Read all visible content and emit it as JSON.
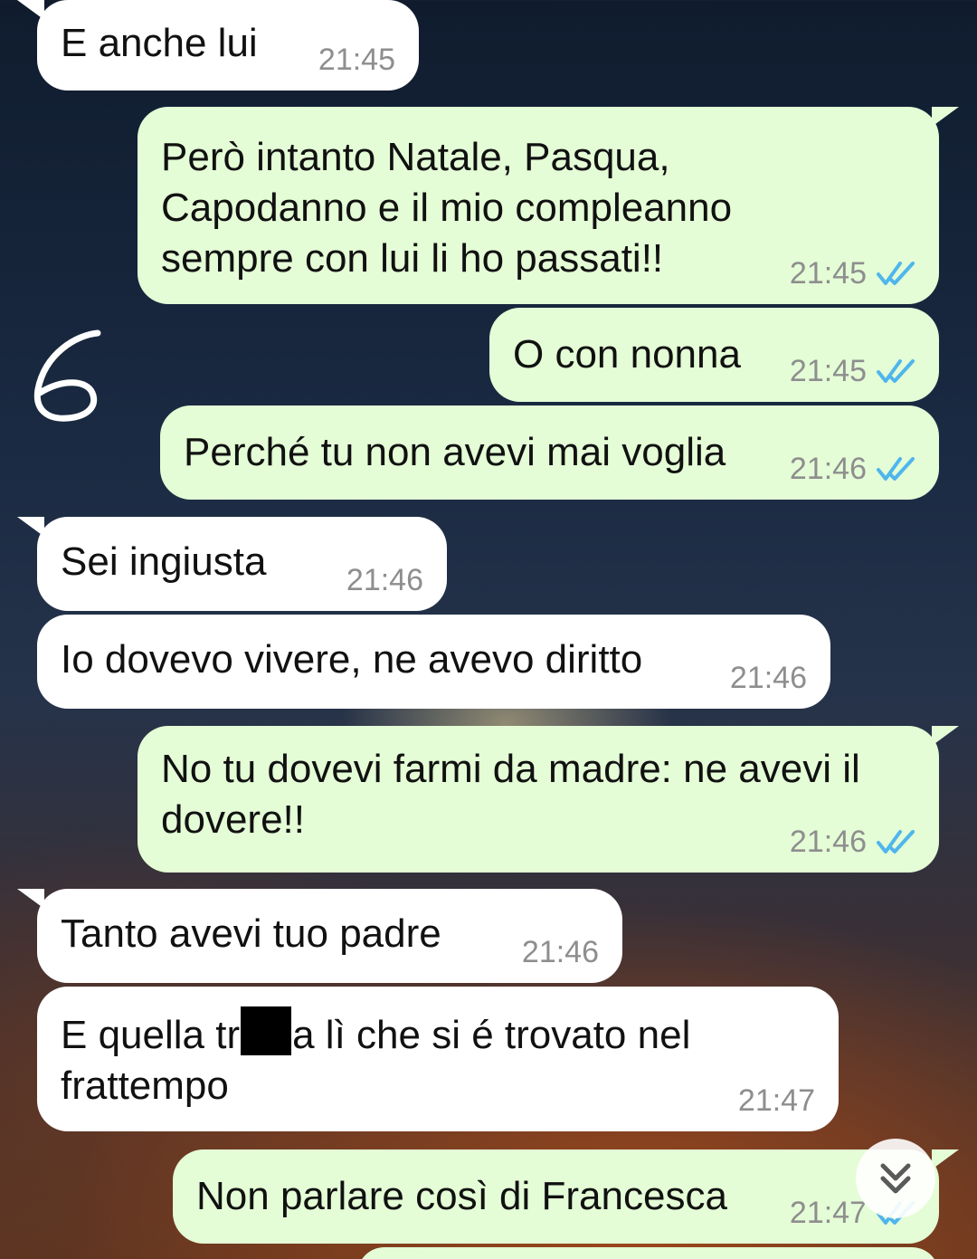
{
  "messages": [
    {
      "direction": "in",
      "text": "E anche lui",
      "time": "21:45"
    },
    {
      "direction": "out",
      "text": "Però intanto Natale, Pasqua,\nCapodanno e il mio compleanno\nsempre con lui li ho passati!!",
      "time": "21:45",
      "status": "read"
    },
    {
      "direction": "out",
      "text": "O con nonna",
      "time": "21:45",
      "status": "read"
    },
    {
      "direction": "out",
      "text": "Perché tu non avevi mai voglia",
      "time": "21:46",
      "status": "read"
    },
    {
      "direction": "in",
      "text": "Sei ingiusta",
      "time": "21:46"
    },
    {
      "direction": "in",
      "text": "Io dovevo vivere, ne avevo diritto",
      "time": "21:46"
    },
    {
      "direction": "out",
      "text": "No tu dovevi farmi da madre: ne avevi il\ndovere!!",
      "time": "21:46",
      "status": "read"
    },
    {
      "direction": "in",
      "text": "Tanto avevi tuo padre",
      "time": "21:46"
    },
    {
      "direction": "in",
      "text_before": "E quella tr",
      "text_after": "a lì che si é trovato nel\nfrattempo",
      "time": "21:47",
      "redacted": true
    },
    {
      "direction": "out",
      "text": "Non parlare così di Francesca",
      "time": "21:47",
      "status": "read"
    }
  ],
  "annotation": {
    "text": "6",
    "color": "#ffffff"
  },
  "colors": {
    "incoming_bubble": "#ffffff",
    "outgoing_bubble": "#e4fdd6",
    "read_ticks": "#4fb6ec",
    "timestamp": "#8e8e8e"
  },
  "icons": {
    "read_receipt": "double-check-icon",
    "scroll_down": "chevron-double-down-icon"
  }
}
